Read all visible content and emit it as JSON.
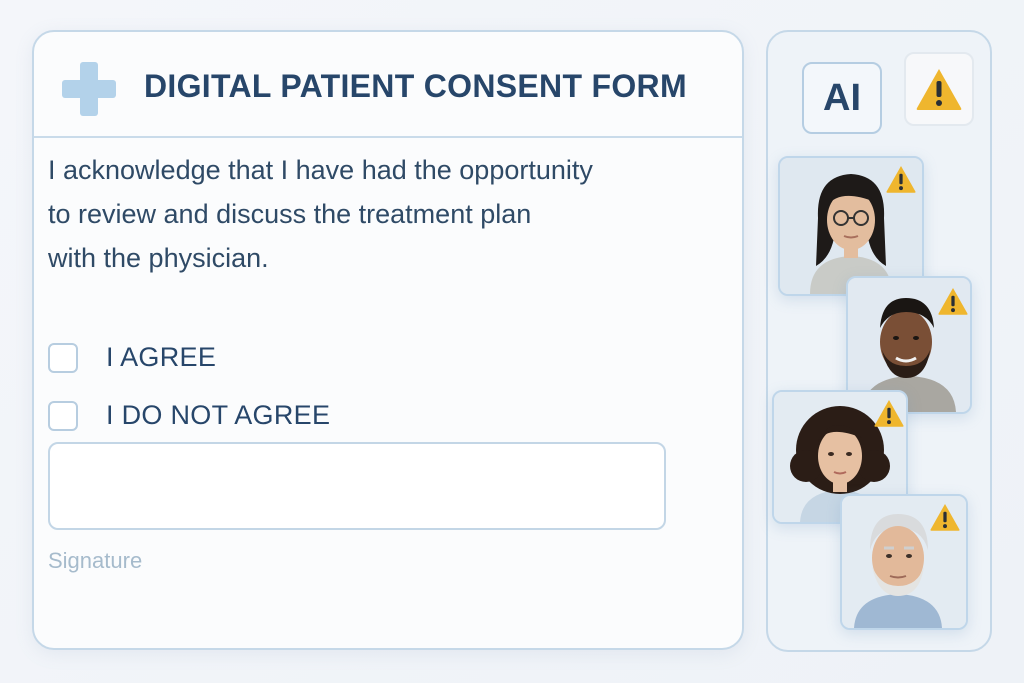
{
  "form": {
    "title": "DIGITAL PATIENT CONSENT FORM",
    "acknowledgement_lines": [
      "I acknowledge that I have had the opportunity",
      "to review and discuss the treatment plan",
      "with the physician."
    ],
    "options": [
      {
        "label": "I AGREE",
        "checked": false
      },
      {
        "label": "I DO NOT AGREE",
        "checked": false
      }
    ],
    "signature": {
      "value": "",
      "label": "Signature"
    }
  },
  "side_panel": {
    "ai_badge": "AI",
    "warning_icon": "warning-triangle-icon",
    "profiles": [
      {
        "icon": "woman-glasses-portrait",
        "warning": true
      },
      {
        "icon": "man-beard-portrait",
        "warning": true
      },
      {
        "icon": "woman-curly-hair-portrait",
        "warning": true
      },
      {
        "icon": "older-man-portrait",
        "warning": true
      }
    ]
  },
  "colors": {
    "accent": "#27466a",
    "border": "#c5d8e8",
    "cross": "#b3d2ea",
    "warning": "#efb62e",
    "muted_label": "#a6bbcc"
  }
}
